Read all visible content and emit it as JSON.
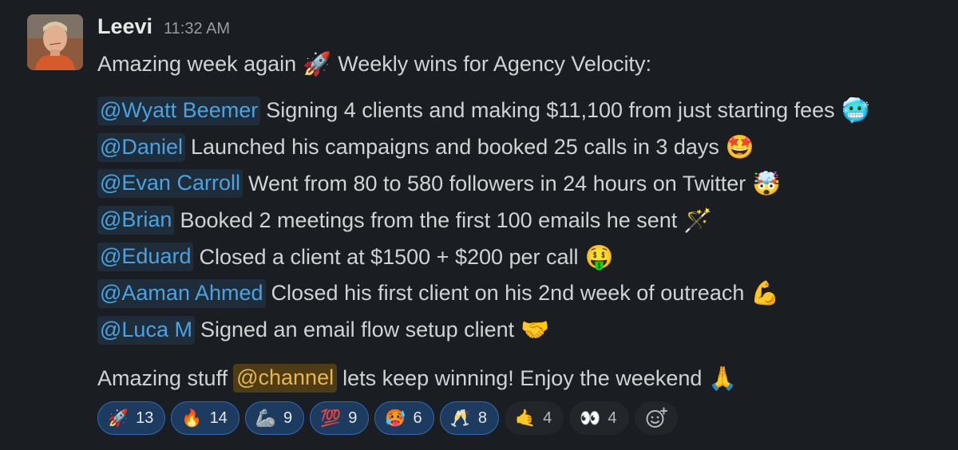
{
  "message": {
    "username": "Leevi",
    "timestamp": "11:32 AM",
    "intro": {
      "before": "Amazing week again",
      "emoji": "🚀",
      "after": "Weekly wins for Agency Velocity:"
    },
    "wins": [
      {
        "mention": "@Wyatt Beemer",
        "text": "Signing 4 clients and making $11,100 from just starting fees",
        "emoji": "🥶",
        "icon": "cold-face-icon"
      },
      {
        "mention": "@Daniel",
        "text": "Launched his campaigns and booked 25 calls in 3 days",
        "emoji": "🤩",
        "icon": "star-struck-icon"
      },
      {
        "mention": "@Evan Carroll",
        "text": "Went from 80 to 580 followers in 24 hours on Twitter",
        "emoji": "🤯",
        "icon": "exploding-head-icon"
      },
      {
        "mention": "@Brian",
        "text": "Booked 2 meetings from the first 100 emails he sent",
        "emoji": "🪄",
        "icon": "magic-wand-icon"
      },
      {
        "mention": "@Eduard",
        "text": "Closed a client at $1500 + $200 per call",
        "emoji": "🤑",
        "icon": "money-mouth-face-icon"
      },
      {
        "mention": "@Aaman Ahmed",
        "text": "Closed his first client on his 2nd week of outreach",
        "emoji": "💪",
        "icon": "flexed-biceps-icon"
      },
      {
        "mention": "@Luca M",
        "text": "Signed an email flow setup client",
        "emoji": "🤝",
        "icon": "handshake-icon"
      }
    ],
    "closing": {
      "before": "Amazing stuff",
      "mention": "@channel",
      "after": "lets keep winning! Enjoy the weekend",
      "emoji": "🙏"
    }
  },
  "reactions": [
    {
      "emoji": "🚀",
      "count": "13",
      "icon": "rocket-icon",
      "reacted": true
    },
    {
      "emoji": "🔥",
      "count": "14",
      "icon": "fire-icon",
      "reacted": true
    },
    {
      "emoji": "🦾",
      "count": "9",
      "icon": "mechanical-arm-icon",
      "reacted": true
    },
    {
      "emoji": "💯",
      "count": "9",
      "icon": "hundred-points-icon",
      "reacted": true
    },
    {
      "emoji": "🥵",
      "count": "6",
      "icon": "hot-face-icon",
      "reacted": true
    },
    {
      "emoji": "🥂",
      "count": "8",
      "icon": "clinking-glasses-icon",
      "reacted": true
    },
    {
      "emoji": "🤙",
      "count": "4",
      "icon": "call-me-hand-icon",
      "reacted": false
    },
    {
      "emoji": "👀",
      "count": "4",
      "icon": "eyes-icon",
      "reacted": false
    }
  ],
  "add_reaction_icon": "add-reaction-icon",
  "colors": {
    "background": "#1a1d21",
    "mention_text": "#4aa3e0",
    "mention_bg": "#1f2d3a",
    "channel_text": "#e8b64c",
    "channel_bg": "#4d3c15",
    "reaction_active_bg": "#1d3a5f",
    "reaction_active_border": "#2e6bb8"
  }
}
